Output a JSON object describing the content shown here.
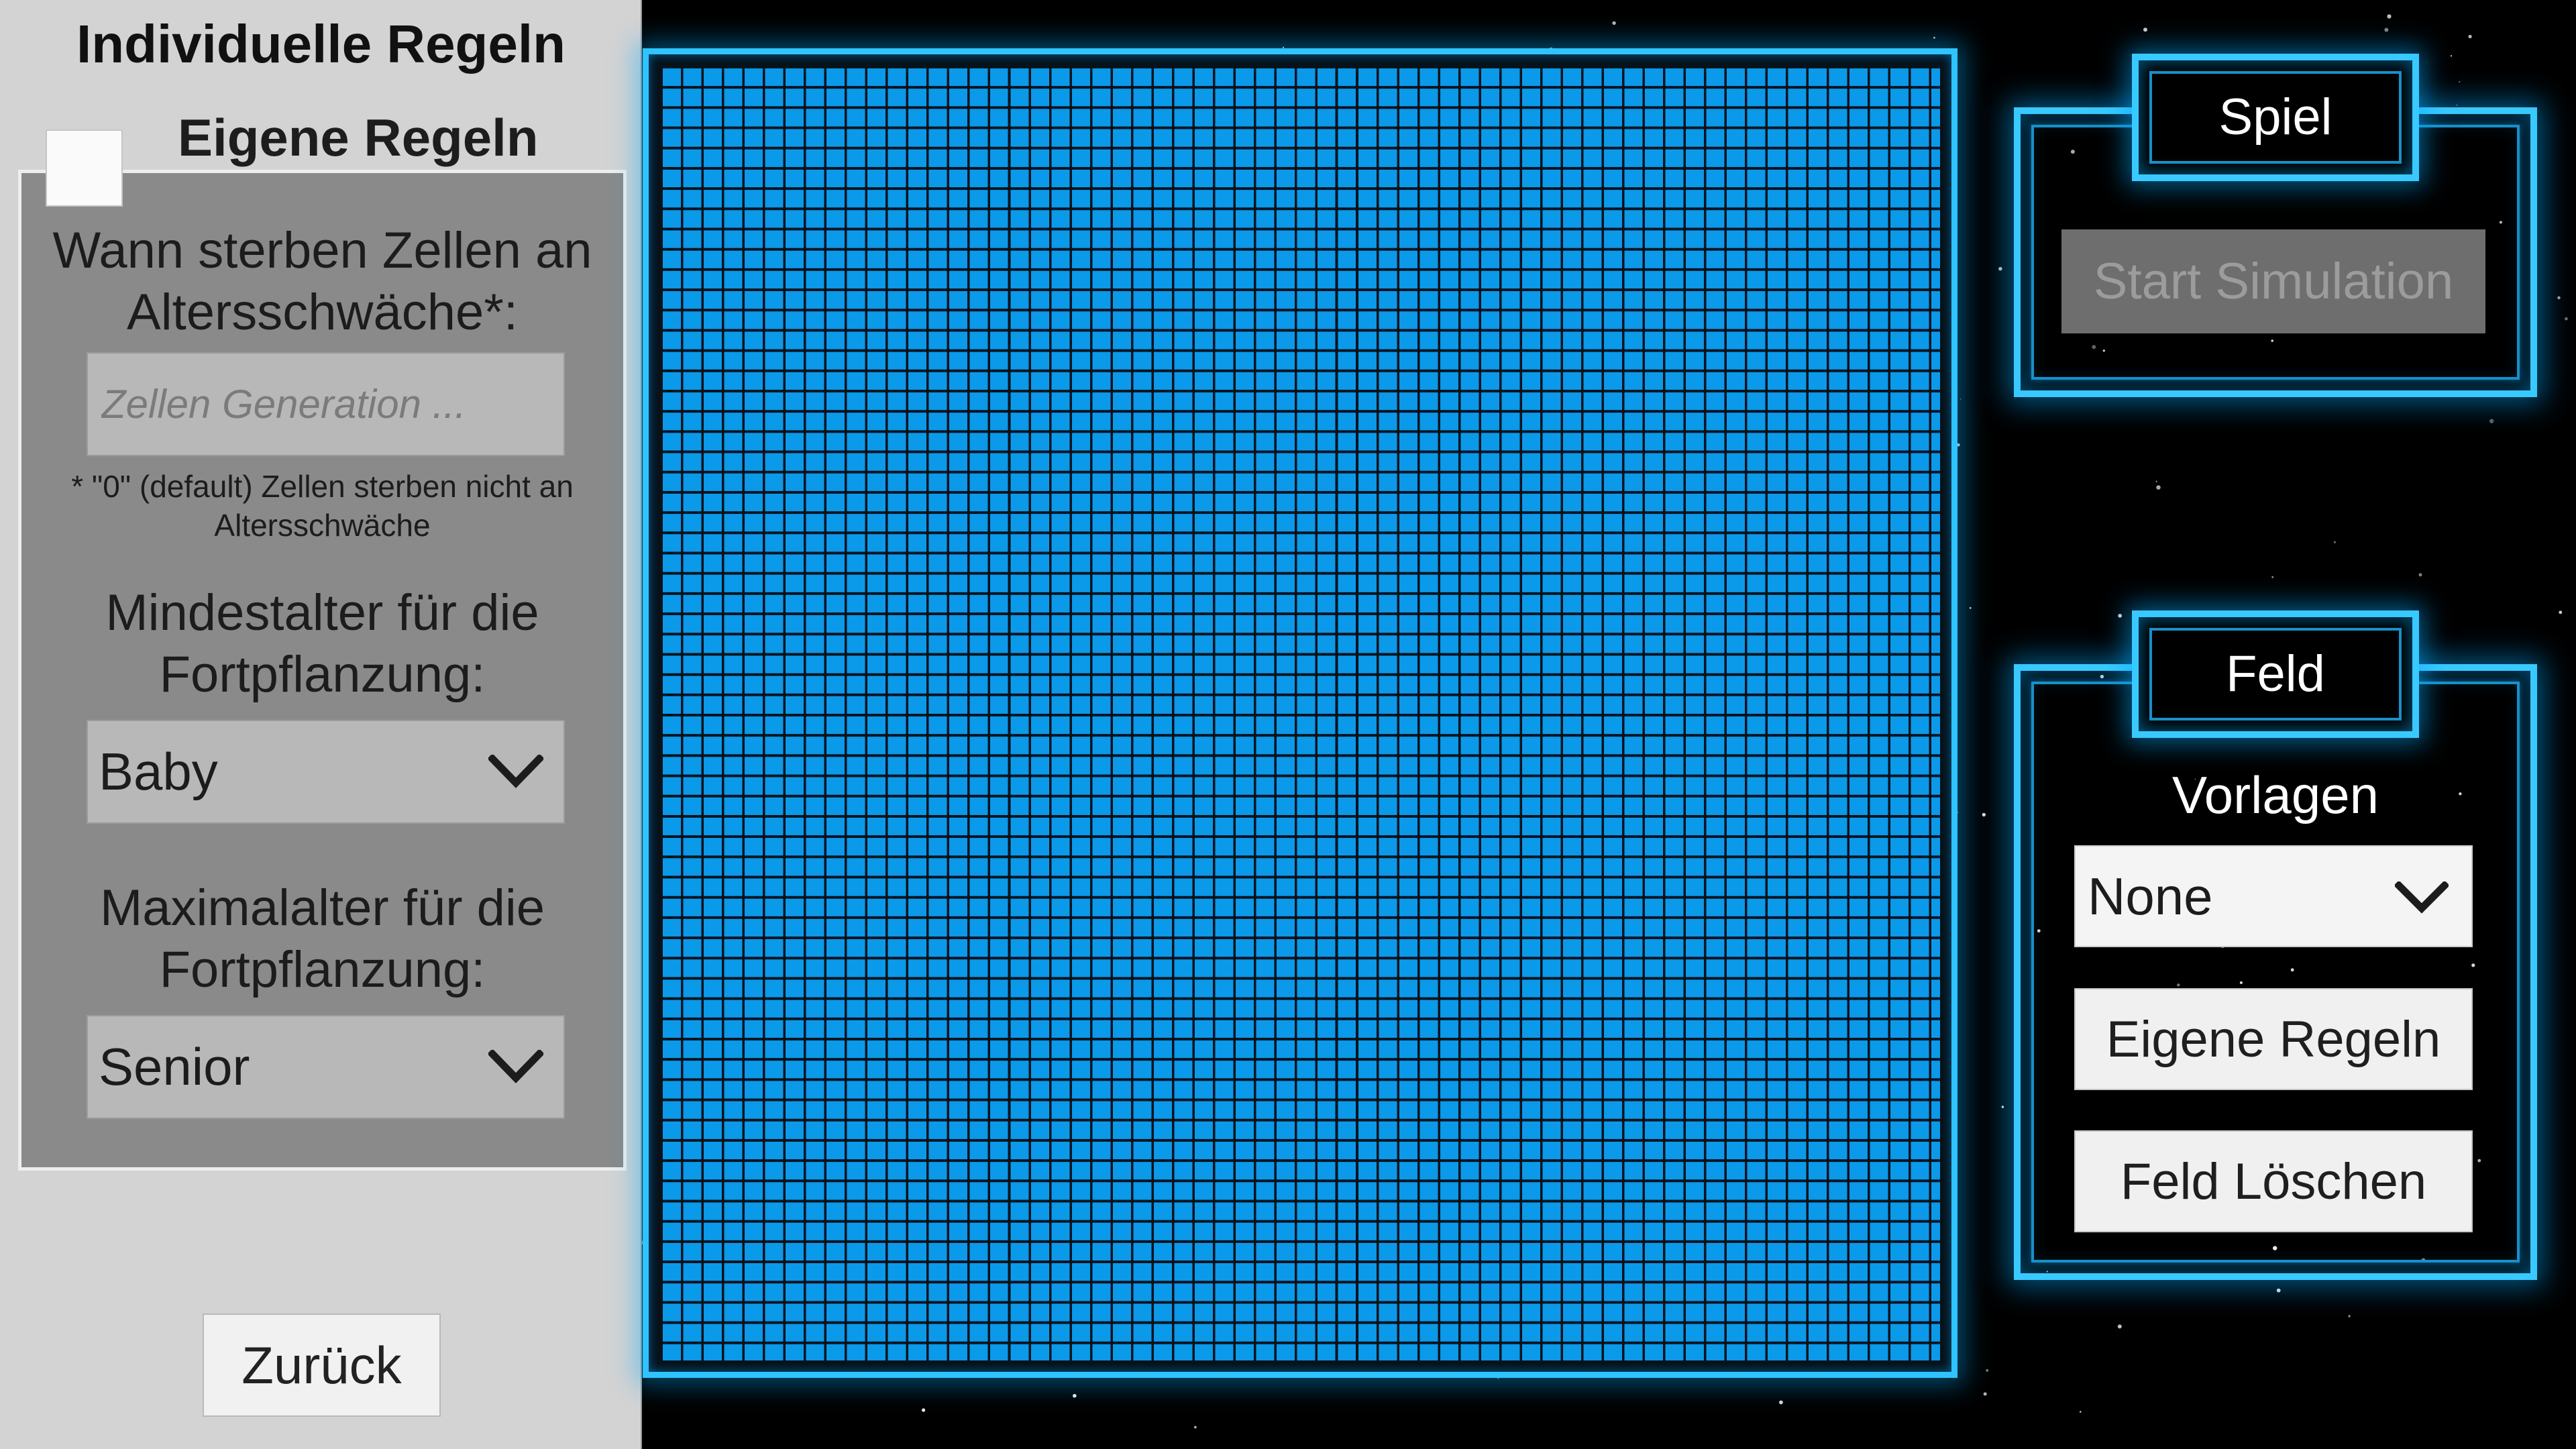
{
  "rules_panel": {
    "title": "Individuelle Regeln",
    "custom_rules_checkbox": {
      "label": "Eigene Regeln",
      "checked": false
    },
    "death_by_age": {
      "question": "Wann sterben Zellen an Altersschwäche*:",
      "input_value": "",
      "input_placeholder": "Zellen Generation ...",
      "note": "* \"0\" (default) Zellen sterben nicht an Altersschwäche"
    },
    "min_age": {
      "question": "Mindestalter für die Fortpflanzung:",
      "selected": "Baby"
    },
    "max_age": {
      "question": "Maximalalter für die Fortpflanzung:",
      "selected": "Senior"
    },
    "back_button": "Zurück"
  },
  "game_panel": {
    "title": "Spiel",
    "start_button": "Start Simulation",
    "start_enabled": false
  },
  "field_panel": {
    "title": "Feld",
    "templates_label": "Vorlagen",
    "templates_selected": "None",
    "custom_rules_button": "Eigene Regeln",
    "clear_button": "Feld Löschen"
  },
  "colors": {
    "neon_accent": "#38c9ff",
    "cell": "#0b99ea",
    "panel_bg": "#d3d3d3",
    "rules_box_bg": "#8a8a8a",
    "disabled_button": "#6e6e6e"
  },
  "icons": {
    "dropdown": "chevron-down-icon"
  }
}
